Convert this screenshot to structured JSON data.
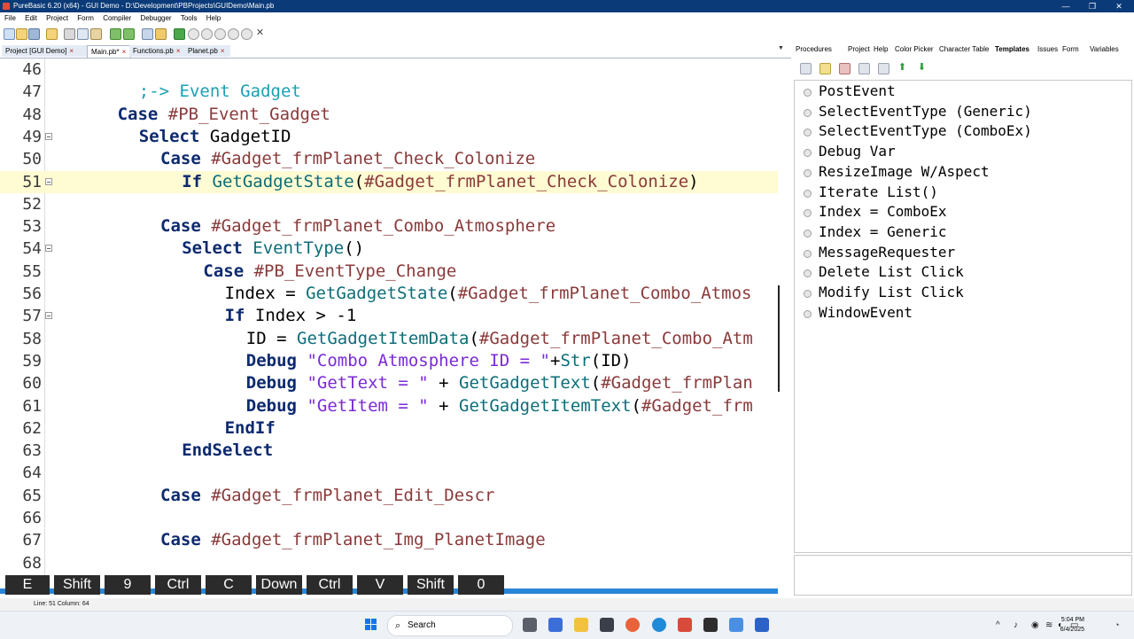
{
  "window": {
    "title": "PureBasic 6.20 (x64) - GUI Demo - D:\\Development\\PBProjects\\GUIDemo\\Main.pb",
    "controls": [
      "—",
      "❐",
      "✕"
    ]
  },
  "menu": [
    "File",
    "Edit",
    "Project",
    "Form",
    "Compiler",
    "Debugger",
    "Tools",
    "Help"
  ],
  "file_tabs": [
    {
      "label": "Project [GUI Demo]",
      "active": false
    },
    {
      "label": "Main.pb*",
      "active": true
    },
    {
      "label": "Functions.pb",
      "active": false
    },
    {
      "label": "Planet.pb",
      "active": false
    }
  ],
  "tab_close_glyph": "×",
  "tabs_dropdown": "▼",
  "editor": {
    "current_line": 51,
    "lines": [
      {
        "n": "46",
        "indent": 0,
        "tokens": []
      },
      {
        "n": "47",
        "indent": 4,
        "tokens": [
          {
            "t": ";-> Event Gadget",
            "c": "cm"
          }
        ]
      },
      {
        "n": "48",
        "indent": 3,
        "tokens": [
          {
            "t": "Case ",
            "c": "kw"
          },
          {
            "t": "#PB_Event_Gadget",
            "c": "const"
          }
        ]
      },
      {
        "n": "49",
        "indent": 4,
        "fold": true,
        "tokens": [
          {
            "t": "Select ",
            "c": "kw"
          },
          {
            "t": "GadgetID",
            "c": "pl"
          }
        ]
      },
      {
        "n": "50",
        "indent": 5,
        "tokens": [
          {
            "t": "Case ",
            "c": "kw"
          },
          {
            "t": "#Gadget_frmPlanet_Check_Colonize",
            "c": "const"
          }
        ]
      },
      {
        "n": "51",
        "indent": 6,
        "fold": true,
        "current": true,
        "tokens": [
          {
            "t": "If ",
            "c": "kw"
          },
          {
            "t": "GetGadgetState",
            "c": "func"
          },
          {
            "t": "(",
            "c": "pl"
          },
          {
            "t": "#Gadget_frmPlanet_Check_Colonize",
            "c": "const"
          },
          {
            "t": ")",
            "c": "pl"
          }
        ]
      },
      {
        "n": "52",
        "indent": 0,
        "tokens": []
      },
      {
        "n": "53",
        "indent": 5,
        "tokens": [
          {
            "t": "Case ",
            "c": "kw"
          },
          {
            "t": "#Gadget_frmPlanet_Combo_Atmosphere",
            "c": "const"
          }
        ]
      },
      {
        "n": "54",
        "indent": 6,
        "fold": true,
        "tokens": [
          {
            "t": "Select ",
            "c": "kw"
          },
          {
            "t": "EventType",
            "c": "func"
          },
          {
            "t": "()",
            "c": "pl"
          }
        ]
      },
      {
        "n": "55",
        "indent": 7,
        "tokens": [
          {
            "t": "Case ",
            "c": "kw"
          },
          {
            "t": "#PB_EventType_Change",
            "c": "const"
          }
        ]
      },
      {
        "n": "56",
        "indent": 8,
        "tokens": [
          {
            "t": "Index = ",
            "c": "pl"
          },
          {
            "t": "GetGadgetState",
            "c": "func"
          },
          {
            "t": "(",
            "c": "pl"
          },
          {
            "t": "#Gadget_frmPlanet_Combo_Atmos",
            "c": "const"
          }
        ]
      },
      {
        "n": "57",
        "indent": 8,
        "fold": true,
        "tokens": [
          {
            "t": "If ",
            "c": "kw"
          },
          {
            "t": "Index > -1",
            "c": "pl"
          }
        ]
      },
      {
        "n": "58",
        "indent": 9,
        "tokens": [
          {
            "t": "ID = ",
            "c": "pl"
          },
          {
            "t": "GetGadgetItemData",
            "c": "func"
          },
          {
            "t": "(",
            "c": "pl"
          },
          {
            "t": "#Gadget_frmPlanet_Combo_Atm",
            "c": "const"
          }
        ]
      },
      {
        "n": "59",
        "indent": 9,
        "tokens": [
          {
            "t": "Debug ",
            "c": "kw"
          },
          {
            "t": "\"Combo Atmosphere ID = \"",
            "c": "str"
          },
          {
            "t": "+",
            "c": "pl"
          },
          {
            "t": "Str",
            "c": "func"
          },
          {
            "t": "(ID)",
            "c": "pl"
          }
        ]
      },
      {
        "n": "60",
        "indent": 9,
        "tokens": [
          {
            "t": "Debug ",
            "c": "kw"
          },
          {
            "t": "\"GetText = \"",
            "c": "str"
          },
          {
            "t": " + ",
            "c": "pl"
          },
          {
            "t": "GetGadgetText",
            "c": "func"
          },
          {
            "t": "(",
            "c": "pl"
          },
          {
            "t": "#Gadget_frmPlan",
            "c": "const"
          }
        ]
      },
      {
        "n": "61",
        "indent": 9,
        "tokens": [
          {
            "t": "Debug ",
            "c": "kw"
          },
          {
            "t": "\"GetItem = \"",
            "c": "str"
          },
          {
            "t": " + ",
            "c": "pl"
          },
          {
            "t": "GetGadgetItemText",
            "c": "func"
          },
          {
            "t": "(",
            "c": "pl"
          },
          {
            "t": "#Gadget_frm",
            "c": "const"
          }
        ]
      },
      {
        "n": "62",
        "indent": 8,
        "tokens": [
          {
            "t": "EndIf",
            "c": "kw"
          }
        ]
      },
      {
        "n": "63",
        "indent": 6,
        "tokens": [
          {
            "t": "EndSelect",
            "c": "kw"
          }
        ]
      },
      {
        "n": "64",
        "indent": 0,
        "tokens": []
      },
      {
        "n": "65",
        "indent": 5,
        "tokens": [
          {
            "t": "Case ",
            "c": "kw"
          },
          {
            "t": "#Gadget_frmPlanet_Edit_Descr",
            "c": "const"
          }
        ]
      },
      {
        "n": "66",
        "indent": 0,
        "tokens": []
      },
      {
        "n": "67",
        "indent": 5,
        "tokens": [
          {
            "t": "Case ",
            "c": "kw"
          },
          {
            "t": "#Gadget_frmPlanet_Img_PlanetImage",
            "c": "const"
          }
        ]
      },
      {
        "n": "68",
        "indent": 0,
        "tokens": []
      }
    ]
  },
  "panel": {
    "tabs": [
      "Procedures",
      "Project",
      "Help",
      "Color Picker",
      "Character Table",
      "Templates",
      "Issues",
      "Form",
      "Variables"
    ],
    "active_tab": "Templates",
    "templates": [
      "PostEvent",
      "SelectEventType (Generic)",
      "SelectEventType (ComboEx)",
      "Debug Var",
      "ResizeImage W/Aspect",
      "Iterate List()",
      "Index = ComboEx",
      "Index = Generic",
      "MessageRequester",
      "Delete List Click",
      "Modify List Click",
      "WindowEvent"
    ]
  },
  "keystrokes": [
    "E",
    "Shift",
    "9",
    "Ctrl",
    "C",
    "Down",
    "Ctrl",
    "V",
    "Shift",
    "0"
  ],
  "status": {
    "text": "Line: 51   Column: 64"
  },
  "taskbar": {
    "search_label": "Search",
    "search_icon": "⌕",
    "time": "5:04 PM",
    "date": "6/4/2025",
    "tray_icons": [
      "^",
      "♪",
      "◉",
      "≋",
      "◐",
      "▭"
    ]
  },
  "colors": {
    "accent": "#2a86d8",
    "titlebar": "#0b3a78",
    "current_line": "#fffbd2"
  }
}
